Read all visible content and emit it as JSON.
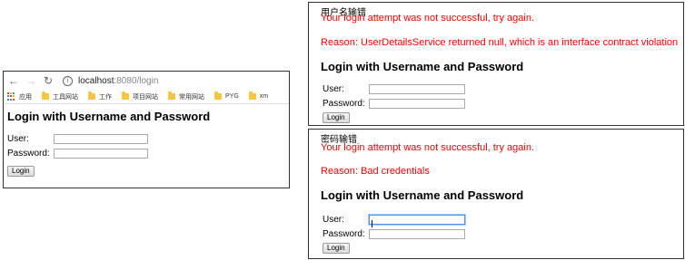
{
  "browser": {
    "url_host": "localhost",
    "url_path": ":8080/login",
    "bookmarks": [
      "应用",
      "工具网站",
      "工作",
      "项目网站",
      "常用网站",
      "PYG",
      "xm"
    ],
    "apps_colors": [
      "#ea4335",
      "#fbbc05",
      "#34a853",
      "#4285f4",
      "#ea4335",
      "#fbbc05",
      "#34a853",
      "#4285f4",
      "#ea4335"
    ]
  },
  "login_page": {
    "title": "Login with Username and Password",
    "user_label": "User:",
    "password_label": "Password:",
    "user_value": "",
    "password_value": "",
    "login_button": "Login"
  },
  "panel_username_error": {
    "caption": "用户名输错",
    "error_line1": "Your login attempt was not successful, try again.",
    "error_line2": "Reason: UserDetailsService returned null, which is an interface contract violation",
    "title": "Login with Username and Password",
    "user_label": "User:",
    "password_label": "Password:",
    "login_button": "Login"
  },
  "panel_password_error": {
    "caption": "密码输错",
    "error_line1": "Your login attempt was not successful, try again.",
    "error_line2": "Reason: Bad credentials",
    "title": "Login with Username and Password",
    "user_label": "User:",
    "password_label": "Password:",
    "login_button": "Login"
  },
  "colors": {
    "error": "#ff0000",
    "folder": "#f5c542",
    "focus": "#4d90fe"
  }
}
